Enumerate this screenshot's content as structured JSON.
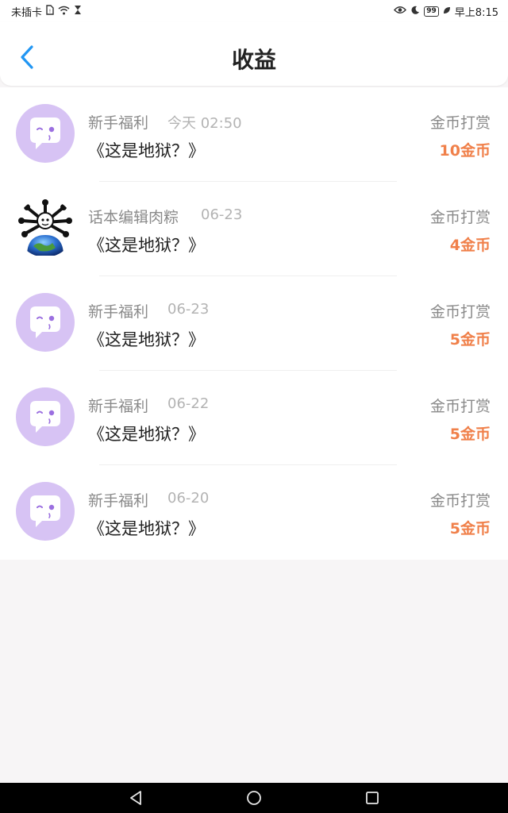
{
  "status_bar": {
    "carrier": "未插卡",
    "battery": "99",
    "time": "早上8:15"
  },
  "header": {
    "title": "收益",
    "back_icon": "chevron-left-icon",
    "accent_color": "#2196f3"
  },
  "records": [
    {
      "sender": "新手福利",
      "time": "今天 02:50",
      "book": "《这是地狱？》",
      "type": "金币打赏",
      "amount": "10金币",
      "avatar": "default"
    },
    {
      "sender": "话本编辑肉粽",
      "time": "06-23",
      "book": "《这是地狱？》",
      "type": "金币打赏",
      "amount": "4金币",
      "avatar": "custom"
    },
    {
      "sender": "新手福利",
      "time": "06-23",
      "book": "《这是地狱？》",
      "type": "金币打赏",
      "amount": "5金币",
      "avatar": "default"
    },
    {
      "sender": "新手福利",
      "time": "06-22",
      "book": "《这是地狱？》",
      "type": "金币打赏",
      "amount": "5金币",
      "avatar": "default"
    },
    {
      "sender": "新手福利",
      "time": "06-20",
      "book": "《这是地狱？》",
      "type": "金币打赏",
      "amount": "5金币",
      "avatar": "default"
    }
  ],
  "colors": {
    "amount": "#f0804a",
    "avatar_bg": "#d7c3f4",
    "avatar_eye": "#9b6fe0"
  }
}
